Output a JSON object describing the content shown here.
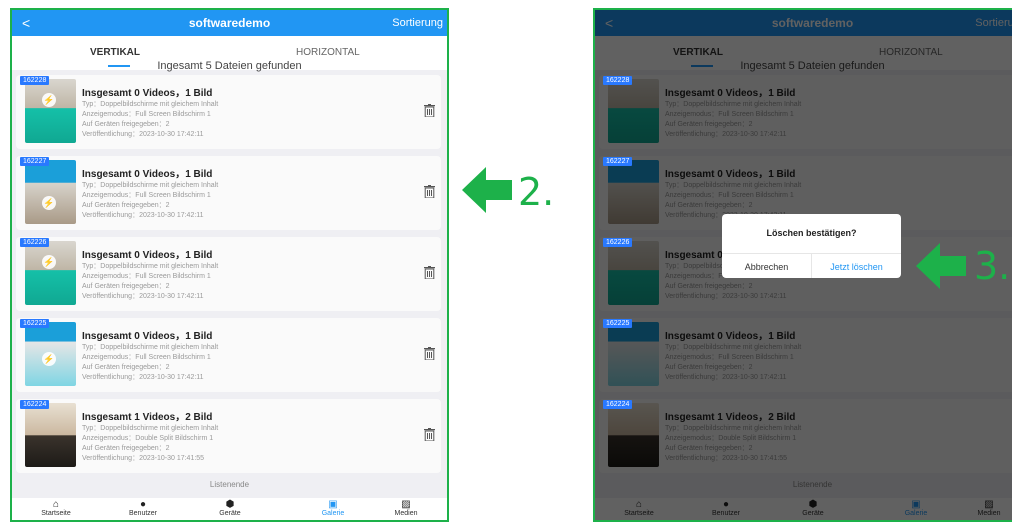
{
  "app": {
    "title": "softwaredemo",
    "back_glyph": "<",
    "sort_label": "Sortierung"
  },
  "tabs": {
    "vertical": "VERTIKAL",
    "horizontal": "HORIZONTAL"
  },
  "file_count_text": "Ingesamt 5 Dateien gefunden",
  "cards": [
    {
      "id": "162228",
      "title": "Insgesamt 0 Videos，1 Bild",
      "type": "Typ：Doppelbildschirme mit gleichem Inhalt",
      "mode": "Anzeigemodus：Full Screen Bildschirm 1",
      "shared": "Auf Geräten freigegeben：2",
      "published": "Veröffentlichung：2023-10-30 17:42:11"
    },
    {
      "id": "162227",
      "title": "Insgesamt 0 Videos，1 Bild",
      "type": "Typ：Doppelbildschirme mit gleichem Inhalt",
      "mode": "Anzeigemodus：Full Screen Bildschirm 1",
      "shared": "Auf Geräten freigegeben：2",
      "published": "Veröffentlichung：2023-10-30 17:42:11"
    },
    {
      "id": "162226",
      "title": "Insgesamt 0 Videos，1 Bild",
      "type": "Typ：Doppelbildschirme mit gleichem Inhalt",
      "mode": "Anzeigemodus：Full Screen Bildschirm 1",
      "shared": "Auf Geräten freigegeben：2",
      "published": "Veröffentlichung：2023-10-30 17:42:11"
    },
    {
      "id": "162225",
      "title": "Insgesamt 0 Videos，1 Bild",
      "type": "Typ：Doppelbildschirme mit gleichem Inhalt",
      "mode": "Anzeigemodus：Full Screen Bildschirm 1",
      "shared": "Auf Geräten freigegeben：2",
      "published": "Veröffentlichung：2023-10-30 17:42:11"
    },
    {
      "id": "162224",
      "title": "Insgesamt 1 Videos，2 Bild",
      "type": "Typ：Doppelbildschirme mit gleichem Inhalt",
      "mode": "Anzeigemodus：Double Split Bildschirm 1",
      "shared": "Auf Geräten freigegeben：2",
      "published": "Veröffentlichung：2023-10-30 17:41:55"
    }
  ],
  "list_end": "Listenende",
  "nav": [
    {
      "label": "Startseite",
      "icon": "home-icon"
    },
    {
      "label": "Benutzer",
      "icon": "user-icon"
    },
    {
      "label": "Geräte",
      "icon": "device-icon"
    },
    {
      "label": "Galerie",
      "icon": "gallery-icon",
      "active": true
    },
    {
      "label": "Medien",
      "icon": "media-icon"
    }
  ],
  "dialog": {
    "title": "Löschen bestätigen?",
    "cancel": "Abbrechen",
    "confirm": "Jetzt löschen"
  },
  "annotations": {
    "step2": "2.",
    "step3": "3."
  },
  "colors": {
    "accent": "#2196f3",
    "frame": "#1db14a",
    "badge": "#2979ff"
  }
}
